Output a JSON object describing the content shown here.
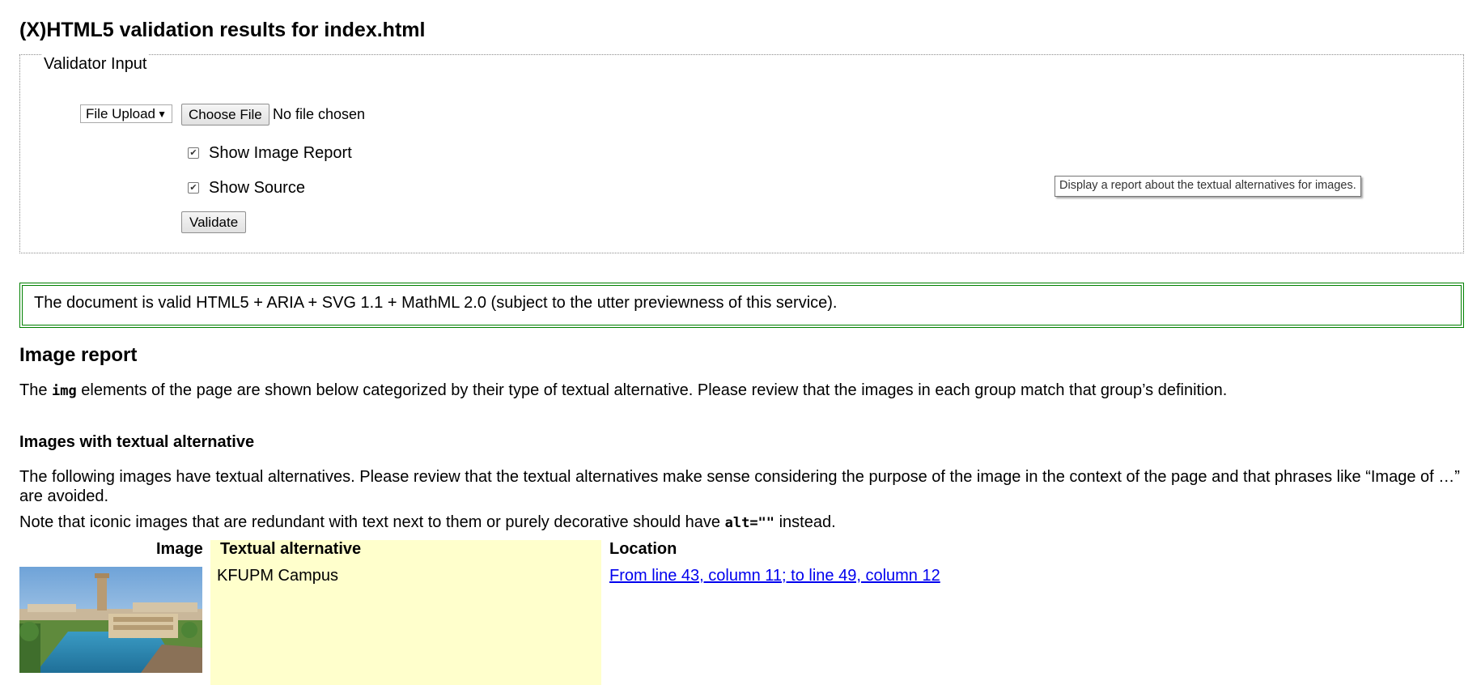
{
  "page": {
    "title": "(X)HTML5 validation results for index.html"
  },
  "validator_input": {
    "legend": "Validator Input",
    "input_mode_select": {
      "selected": "File Upload"
    },
    "choose_file_button": "Choose File",
    "file_status": "No file chosen",
    "show_image_report": {
      "label": "Show Image Report",
      "checked": true
    },
    "show_source": {
      "label": "Show Source",
      "checked": true
    },
    "validate_button": "Validate",
    "tooltip": "Display a report about the textual alternatives for images."
  },
  "result": {
    "message": "The document is valid HTML5 + ARIA + SVG 1.1 + MathML 2.0 (subject to the utter previewness of this service).",
    "border_color": "#008000"
  },
  "image_report": {
    "heading": "Image report",
    "intro_before": "The ",
    "intro_code": "img",
    "intro_after": " elements of the page are shown below categorized by their type of textual alternative. Please review that the images in each group match that group’s definition.",
    "section_heading": "Images with textual alternative",
    "section_desc": "The following images have textual alternatives. Please review that the textual alternatives make sense considering the purpose of the image in the context of the page and that phrases like “Image of …” are avoided.",
    "note_before": "Note that iconic images that are redundant with text next to them or purely decorative should have ",
    "note_code": "alt=\"\"",
    "note_after": " instead.",
    "table": {
      "headers": {
        "image": "Image",
        "alt": "Textual alternative",
        "location": "Location"
      },
      "rows": [
        {
          "alt": "KFUPM Campus",
          "location": "From line 43, column 11; to line 49, column 12"
        }
      ],
      "alt_column_bg": "#ffffcc"
    }
  },
  "colors": {
    "link": "#0000ee"
  }
}
